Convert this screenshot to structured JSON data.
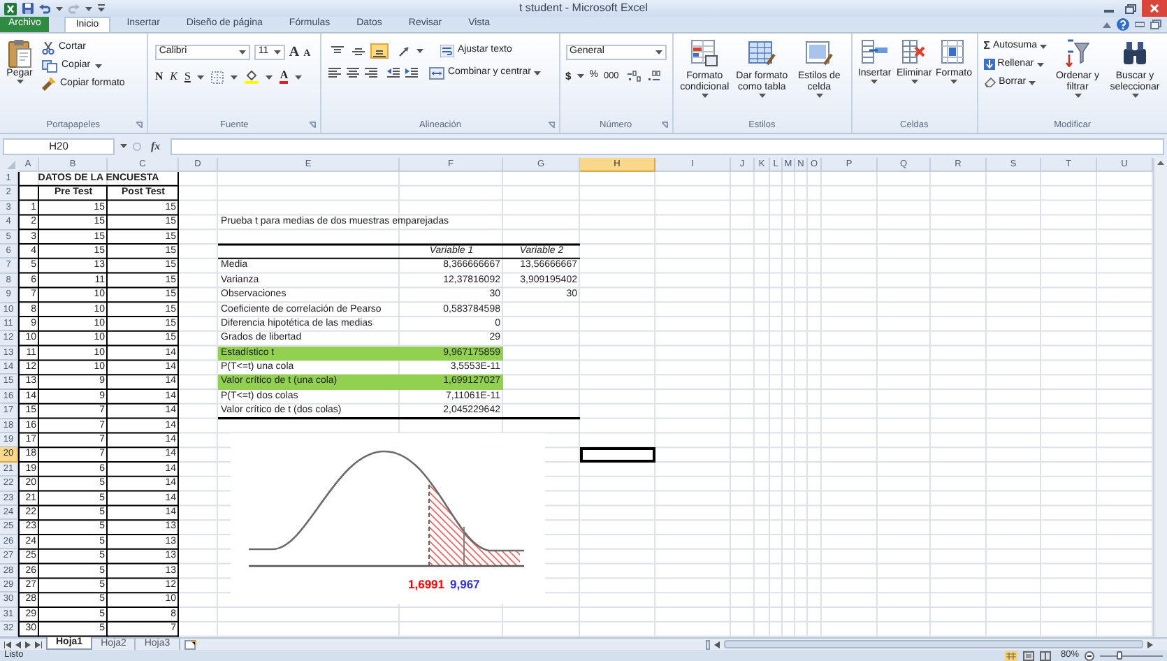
{
  "window": {
    "title": "t student - Microsoft Excel"
  },
  "tabs": [
    {
      "label": "Archivo",
      "kind": "file",
      "selected": false
    },
    {
      "label": "Inicio",
      "kind": "tab",
      "selected": true
    },
    {
      "label": "Insertar",
      "kind": "tab",
      "selected": false
    },
    {
      "label": "Diseño de página",
      "kind": "tab",
      "selected": false
    },
    {
      "label": "Fórmulas",
      "kind": "tab",
      "selected": false
    },
    {
      "label": "Datos",
      "kind": "tab",
      "selected": false
    },
    {
      "label": "Revisar",
      "kind": "tab",
      "selected": false
    },
    {
      "label": "Vista",
      "kind": "tab",
      "selected": false
    }
  ],
  "ribbon": {
    "clipboard": {
      "label": "Portapapeles",
      "paste": "Pegar",
      "cut": "Cortar",
      "copy": "Copiar",
      "format_painter": "Copiar formato"
    },
    "font": {
      "label": "Fuente",
      "font_name": "Calibri",
      "font_size": "11",
      "grow": "A",
      "shrink": "A",
      "bold": "N",
      "italic": "K",
      "underline": "S",
      "font_color": "A"
    },
    "alignment": {
      "label": "Alineación",
      "vertical_align": [
        {
          "selected": false
        },
        {
          "selected": false
        },
        {
          "selected": true
        }
      ],
      "wrap_text": "Ajustar texto",
      "merge": "Combinar y centrar"
    },
    "number": {
      "label": "Número",
      "format": "General",
      "currency": "$",
      "percent": "%",
      "thousands": "000"
    },
    "styles": {
      "label": "Estilos",
      "buttons": [
        "Formato condicional",
        "Dar formato como tabla",
        "Estilos de celda"
      ]
    },
    "cells": {
      "label": "Celdas",
      "buttons": [
        "Insertar",
        "Eliminar",
        "Formato"
      ]
    },
    "editing": {
      "label": "Modificar",
      "autosum_symbol": "Σ",
      "autosum": "Autosuma",
      "fill": "Rellenar",
      "clear": "Borrar",
      "sort": "Ordenar y filtrar",
      "find": "Buscar y seleccionar"
    }
  },
  "formula_bar": {
    "name_box": "H20",
    "function_label": "fx"
  },
  "columns": [
    {
      "label": "A",
      "selected": false
    },
    {
      "label": "B",
      "selected": false
    },
    {
      "label": "C",
      "selected": false
    },
    {
      "label": "D",
      "selected": false
    },
    {
      "label": "E",
      "selected": false
    },
    {
      "label": "F",
      "selected": false
    },
    {
      "label": "G",
      "selected": false
    },
    {
      "label": "H",
      "selected": true
    },
    {
      "label": "I",
      "selected": false
    },
    {
      "label": "J",
      "selected": false
    },
    {
      "label": "K",
      "selected": false
    },
    {
      "label": "L",
      "selected": false
    },
    {
      "label": "M",
      "selected": false
    },
    {
      "label": "N",
      "selected": false
    },
    {
      "label": "O",
      "selected": false
    },
    {
      "label": "P",
      "selected": false
    },
    {
      "label": "Q",
      "selected": false
    },
    {
      "label": "R",
      "selected": false
    },
    {
      "label": "S",
      "selected": false
    },
    {
      "label": "T",
      "selected": false
    },
    {
      "label": "U",
      "selected": false
    }
  ],
  "rows": [
    {
      "label": "1",
      "selected": false
    },
    {
      "label": "2",
      "selected": false
    },
    {
      "label": "3",
      "selected": false
    },
    {
      "label": "4",
      "selected": false
    },
    {
      "label": "5",
      "selected": false
    },
    {
      "label": "6",
      "selected": false
    },
    {
      "label": "7",
      "selected": false
    },
    {
      "label": "8",
      "selected": false
    },
    {
      "label": "9",
      "selected": false
    },
    {
      "label": "10",
      "selected": false
    },
    {
      "label": "11",
      "selected": false
    },
    {
      "label": "12",
      "selected": false
    },
    {
      "label": "13",
      "selected": false
    },
    {
      "label": "14",
      "selected": false
    },
    {
      "label": "15",
      "selected": false
    },
    {
      "label": "16",
      "selected": false
    },
    {
      "label": "17",
      "selected": false
    },
    {
      "label": "18",
      "selected": false
    },
    {
      "label": "19",
      "selected": false
    },
    {
      "label": "20",
      "selected": true
    },
    {
      "label": "21",
      "selected": false
    },
    {
      "label": "22",
      "selected": false
    },
    {
      "label": "23",
      "selected": false
    },
    {
      "label": "24",
      "selected": false
    },
    {
      "label": "25",
      "selected": false
    },
    {
      "label": "26",
      "selected": false
    },
    {
      "label": "27",
      "selected": false
    },
    {
      "label": "28",
      "selected": false
    },
    {
      "label": "29",
      "selected": false
    },
    {
      "label": "30",
      "selected": false
    },
    {
      "label": "31",
      "selected": false
    },
    {
      "label": "32",
      "selected": false
    }
  ],
  "data_table": {
    "title": "DATOS DE LA ENCUESTA",
    "headers": [
      "Pre Test",
      "Post Test"
    ],
    "rows": [
      [
        "1",
        "15",
        "15"
      ],
      [
        "2",
        "15",
        "15"
      ],
      [
        "3",
        "15",
        "15"
      ],
      [
        "4",
        "15",
        "15"
      ],
      [
        "5",
        "13",
        "15"
      ],
      [
        "6",
        "11",
        "15"
      ],
      [
        "7",
        "10",
        "15"
      ],
      [
        "8",
        "10",
        "15"
      ],
      [
        "9",
        "10",
        "15"
      ],
      [
        "10",
        "10",
        "15"
      ],
      [
        "11",
        "10",
        "14"
      ],
      [
        "12",
        "10",
        "14"
      ],
      [
        "13",
        "9",
        "14"
      ],
      [
        "14",
        "9",
        "14"
      ],
      [
        "15",
        "7",
        "14"
      ],
      [
        "16",
        "7",
        "14"
      ],
      [
        "17",
        "7",
        "14"
      ],
      [
        "18",
        "7",
        "14"
      ],
      [
        "19",
        "6",
        "14"
      ],
      [
        "20",
        "5",
        "14"
      ],
      [
        "21",
        "5",
        "14"
      ],
      [
        "22",
        "5",
        "14"
      ],
      [
        "23",
        "5",
        "13"
      ],
      [
        "24",
        "5",
        "13"
      ],
      [
        "25",
        "5",
        "13"
      ],
      [
        "26",
        "5",
        "13"
      ],
      [
        "27",
        "5",
        "12"
      ],
      [
        "28",
        "5",
        "10"
      ],
      [
        "29",
        "5",
        "8"
      ],
      [
        "30",
        "5",
        "7"
      ]
    ]
  },
  "stats": {
    "title": "Prueba t para medias de dos muestras emparejadas",
    "headers": [
      "Variable 1",
      "Variable 2"
    ],
    "rows": [
      {
        "label": "Media",
        "values": [
          "8,366666667",
          "13,56666667"
        ],
        "highlighted": false
      },
      {
        "label": "Varianza",
        "values": [
          "12,37816092",
          "3,909195402"
        ],
        "highlighted": false
      },
      {
        "label": "Observaciones",
        "values": [
          "30",
          "30"
        ],
        "highlighted": false
      },
      {
        "label": "Coeficiente de correlación de Pearso",
        "values": [
          "0,583784598"
        ],
        "highlighted": false
      },
      {
        "label": "Diferencia hipotética de las medias",
        "values": [
          "0"
        ],
        "highlighted": false
      },
      {
        "label": "Grados de libertad",
        "values": [
          "29"
        ],
        "highlighted": false
      },
      {
        "label": "Estadístico t",
        "values": [
          "9,967175859"
        ],
        "highlighted": true
      },
      {
        "label": "P(T<=t) una cola",
        "values": [
          "3,5553E-11"
        ],
        "highlighted": false
      },
      {
        "label": "Valor crítico de t (una cola)",
        "values": [
          "1,699127027"
        ],
        "highlighted": true
      },
      {
        "label": "P(T<=t) dos colas",
        "values": [
          "7,11061E-11"
        ],
        "highlighted": false
      },
      {
        "label": "Valor crítico de t (dos colas)",
        "values": [
          "2,045229642"
        ],
        "highlighted": false
      }
    ]
  },
  "chart_labels": [
    {
      "text": "1,6991",
      "color": "#ff0000"
    },
    {
      "text": "9,967",
      "color": "#3333cc"
    }
  ],
  "sheet_tabs": [
    {
      "label": "Hoja1",
      "selected": true
    },
    {
      "label": "Hoja2",
      "selected": false
    },
    {
      "label": "Hoja3",
      "selected": false
    }
  ],
  "status_bar": {
    "text": "Listo",
    "zoom": "80%",
    "zoom_slider": {
      "level": 0.3
    }
  }
}
